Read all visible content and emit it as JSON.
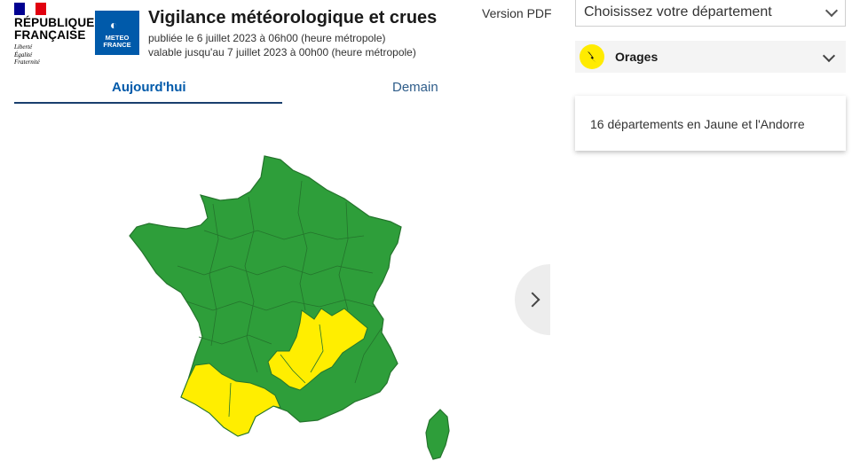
{
  "header": {
    "republic_line1": "RÉPUBLIQUE",
    "republic_line2": "FRANÇAISE",
    "motto_1": "Liberté",
    "motto_2": "Égalité",
    "motto_3": "Fraternité",
    "meteo_line1": "METEO",
    "meteo_line2": "FRANCE",
    "title": "Vigilance météorologique et crues",
    "published": "publiée le 6 juillet 2023 à 06h00 (heure métropole)",
    "valid_until": "valable jusqu'au 7 juillet 2023 à 00h00 (heure métropole)",
    "pdf_link": "Version PDF"
  },
  "department_select": {
    "placeholder": "Choisissez votre département"
  },
  "phenomenon": {
    "label": "Orages",
    "icon": "storm-lightning-icon",
    "icon_color": "#ffeb00"
  },
  "info_card": {
    "text": "16 départements en Jaune et l'Andorre"
  },
  "tabs": [
    {
      "label": "Aujourd'hui",
      "active": true
    },
    {
      "label": "Demain",
      "active": false
    }
  ],
  "map": {
    "colors": {
      "green": "#2e9e3a",
      "yellow": "#ffee00",
      "border": "#24742c"
    }
  }
}
